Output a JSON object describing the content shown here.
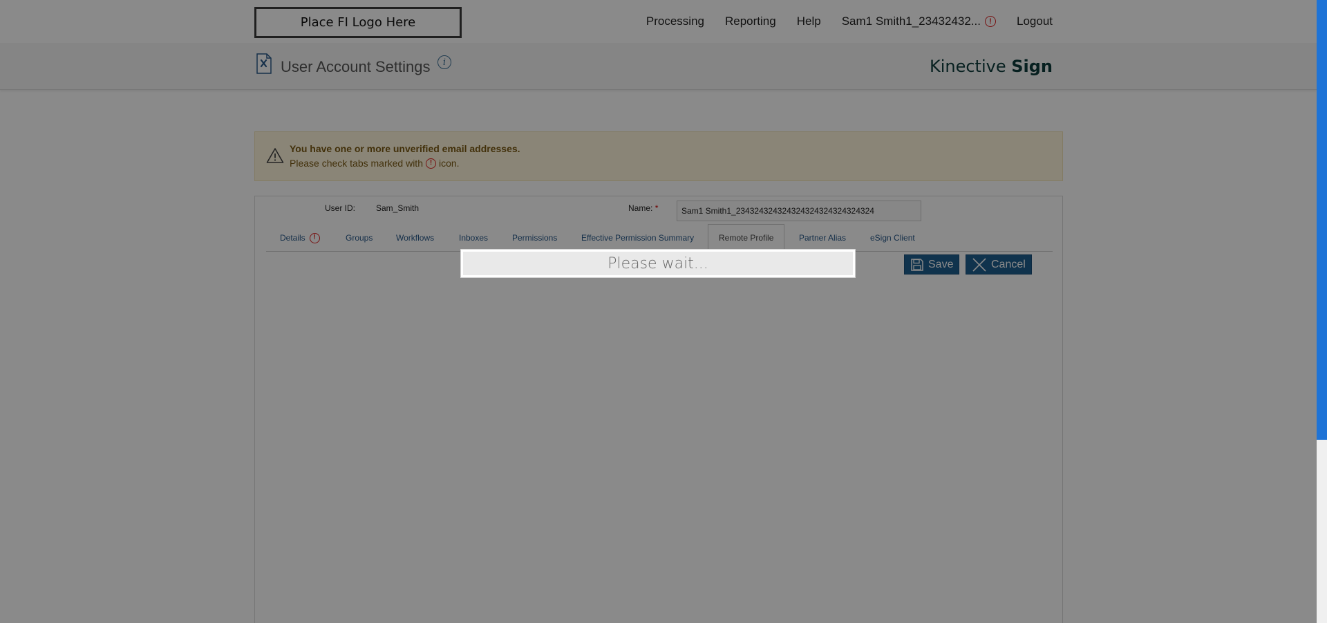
{
  "nav": {
    "logo": "Place FI Logo Here",
    "links": [
      "Processing",
      "Reporting",
      "Help"
    ],
    "user": "Sam1 Smith1_23432432...",
    "logout": "Logout"
  },
  "header": {
    "title": "User Account Settings",
    "info_glyph": "i",
    "brand_prefix": "Kinective",
    "brand_suffix": "Sign"
  },
  "warning": {
    "title": "You have one or more unverified email addresses.",
    "text_before": "Please check tabs marked with",
    "text_after": "icon."
  },
  "form": {
    "user_id_label": "User ID:",
    "user_id_value": "Sam_Smith",
    "name_label": "Name:",
    "name_required": "*",
    "name_value": "Sam1 Smith1_234324324324324324324324324324"
  },
  "tabs": [
    {
      "label": "Details",
      "alert": true
    },
    {
      "label": "Groups"
    },
    {
      "label": "Workflows"
    },
    {
      "label": "Inboxes"
    },
    {
      "label": "Permissions"
    },
    {
      "label": "Effective Permission Summary"
    },
    {
      "label": "Remote Profile",
      "active": true
    },
    {
      "label": "Partner Alias"
    },
    {
      "label": "eSign Client"
    }
  ],
  "buttons": {
    "save": "Save",
    "cancel": "Cancel"
  },
  "overlay": {
    "message": "Please wait..."
  },
  "alert_glyph": "!",
  "colors": {
    "primary_button": "#1f5f8f",
    "alert": "#dd2222",
    "warning_bg": "#fff6dc",
    "scroll_thumb": "#1e73d6"
  }
}
